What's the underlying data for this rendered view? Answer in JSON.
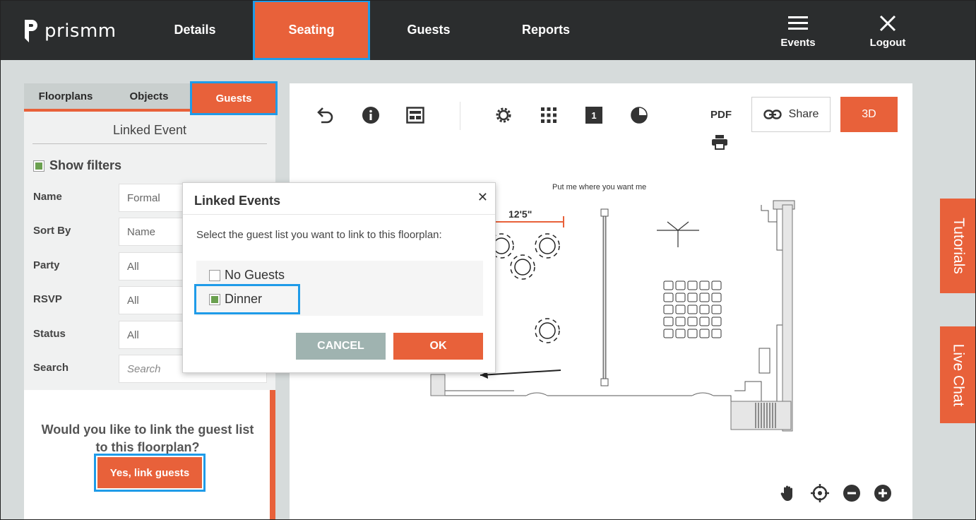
{
  "brand": {
    "name": "prismm"
  },
  "nav": [
    {
      "label": "Details",
      "active": false
    },
    {
      "label": "Seating",
      "active": true
    },
    {
      "label": "Guests",
      "active": false
    },
    {
      "label": "Reports",
      "active": false
    }
  ],
  "top_actions": {
    "events": "Events",
    "logout": "Logout"
  },
  "panel": {
    "tabs": [
      {
        "label": "Floorplans",
        "active": false
      },
      {
        "label": "Objects",
        "active": false
      },
      {
        "label": "Guests",
        "active": true
      }
    ],
    "linked_event_title": "Linked Event",
    "show_filters": "Show filters",
    "filters": [
      {
        "label": "Name",
        "value": "Formal"
      },
      {
        "label": "Sort By",
        "value": "Name"
      },
      {
        "label": "Party",
        "value": "All"
      },
      {
        "label": "RSVP",
        "value": "All"
      },
      {
        "label": "Status",
        "value": "All"
      },
      {
        "label": "Search",
        "value": "",
        "placeholder": "Search"
      }
    ],
    "link_question": "Would you like to link the guest list to this floorplan?",
    "link_button": "Yes, link guests"
  },
  "toolbar": {
    "icons": [
      "undo-icon",
      "info-icon",
      "layout-icon",
      "settings-icon",
      "grid-icon",
      "table-number-icon",
      "pie-icon"
    ],
    "table_number": "1",
    "pdf": "PDF",
    "share": "Share",
    "three_d": "3D"
  },
  "canvas": {
    "note": "Put me where you want me",
    "dimension": "12'5\""
  },
  "side_tabs": {
    "tutorials": "Tutorials",
    "live_chat": "Live Chat"
  },
  "modal": {
    "title": "Linked Events",
    "description": "Select the guest list you want to link to this floorplan:",
    "options": [
      {
        "label": "No Guests",
        "checked": false
      },
      {
        "label": "Dinner",
        "checked": true
      }
    ],
    "cancel": "CANCEL",
    "ok": "OK"
  },
  "colors": {
    "accent": "#e8613a",
    "topbar": "#2b2d2e",
    "highlight": "#1f9be8",
    "cancel": "#9fb3b0"
  }
}
